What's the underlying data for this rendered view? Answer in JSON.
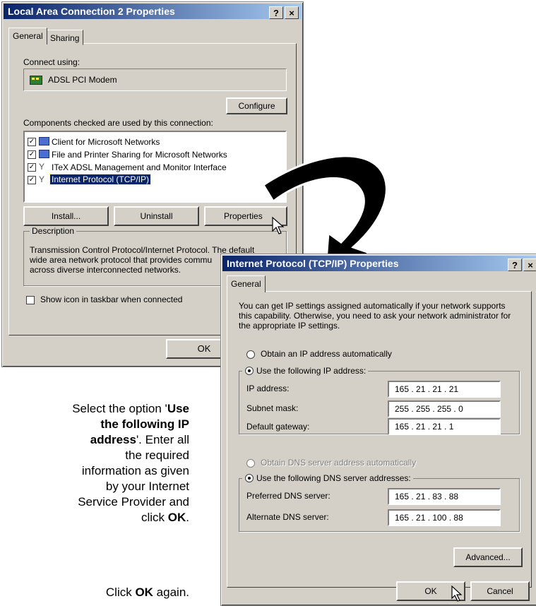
{
  "lan_dialog": {
    "title": "Local Area Connection 2 Properties",
    "help_btn": "?",
    "close_btn": "×",
    "tabs": [
      "General",
      "Sharing"
    ],
    "connect_using_label": "Connect using:",
    "adapter_name": "ADSL PCI Modem",
    "configure_label": "Configure",
    "components_label": "Components checked are used by this connection:",
    "components": [
      {
        "label": "Client for Microsoft Networks",
        "checked": true,
        "icon": "network-client-icon"
      },
      {
        "label": "File and Printer Sharing for Microsoft Networks",
        "checked": true,
        "icon": "file-printer-sharing-icon"
      },
      {
        "label": "ITeX ADSL Management and Monitor Interface",
        "checked": true,
        "icon": "protocol-icon"
      },
      {
        "label": "Internet Protocol (TCP/IP)",
        "checked": true,
        "icon": "protocol-icon",
        "selected": true
      }
    ],
    "install_label": "Install...",
    "uninstall_label": "Uninstall",
    "properties_label": "Properties",
    "description_legend": "Description",
    "description_text": [
      "Transmission Control Protocol/Internet Protocol. The default",
      "wide area network protocol that provides commu",
      "across diverse interconnected networks."
    ],
    "show_icon_label": "Show icon in taskbar when connected",
    "ok_label": "OK"
  },
  "tcp_dialog": {
    "title": "Internet Protocol (TCP/IP) Properties",
    "help_btn": "?",
    "close_btn": "×",
    "tab": "General",
    "intro": [
      "You can get IP settings assigned automatically if your network supports",
      "this capability. Otherwise, you need to ask your network administrator for",
      "the appropriate IP settings."
    ],
    "obtain_ip_auto": "Obtain an IP address automatically",
    "use_following_ip": "Use the following IP address:",
    "ip_address_label": "IP address:",
    "ip_address": "165 .  21  .  21  .  21",
    "subnet_label": "Subnet mask:",
    "subnet_mask": "255 . 255 . 255 .  0",
    "gateway_label": "Default gateway:",
    "default_gateway": "165 .  21  .  21  .  1",
    "obtain_dns_auto": "Obtain DNS server address automatically",
    "use_following_dns": "Use the following DNS server addresses:",
    "preferred_dns_label": "Preferred DNS server:",
    "preferred_dns": "165 .  21  .  83  .  88",
    "alternate_dns_label": "Alternate DNS server:",
    "alternate_dns": "165 .  21  . 100 .  88",
    "advanced_label": "Advanced...",
    "ok_label": "OK",
    "cancel_label": "Cancel"
  },
  "instructions": {
    "line1_a": "Select the option '",
    "line1_b": "Use",
    "line2": "the following IP",
    "line3_a": "address",
    "line3_b": "'.  Enter all",
    "line4": "the required",
    "line5": "information as given",
    "line6": "by your Internet",
    "line7": "Service Provider and",
    "line8_a": "click ",
    "line8_b": "OK",
    "line8_c": ".",
    "line9_a": "Click ",
    "line9_b": "OK",
    "line9_c": " again."
  },
  "colors": {
    "titlebar_start": "#0a246a",
    "titlebar_end": "#a6caf0",
    "dialog_face": "#d4d0c8",
    "selection": "#0a246a"
  }
}
